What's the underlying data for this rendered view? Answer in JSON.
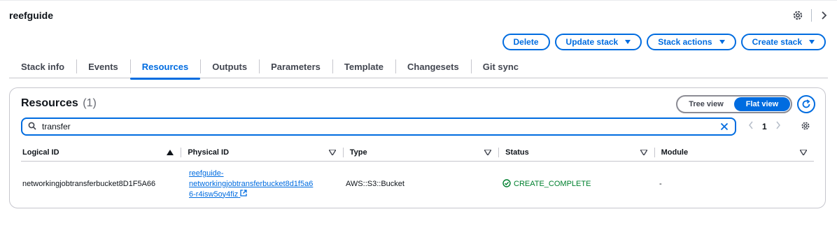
{
  "header": {
    "title": "reefguide",
    "icons": [
      "gear-icon",
      "chevron-right-icon"
    ]
  },
  "actions": {
    "delete": "Delete",
    "update": "Update stack",
    "stack_actions": "Stack actions",
    "create": "Create stack"
  },
  "tabs": [
    {
      "label": "Stack info"
    },
    {
      "label": "Events"
    },
    {
      "label": "Resources"
    },
    {
      "label": "Outputs"
    },
    {
      "label": "Parameters"
    },
    {
      "label": "Template"
    },
    {
      "label": "Changesets"
    },
    {
      "label": "Git sync"
    }
  ],
  "active_tab": "Resources",
  "resources": {
    "title": "Resources",
    "count": "(1)",
    "view_toggle": {
      "tree": "Tree view",
      "flat": "Flat view",
      "selected": "Flat view"
    },
    "search": {
      "value": "transfer"
    },
    "pagination": {
      "page": "1"
    },
    "columns": [
      "Logical ID",
      "Physical ID",
      "Type",
      "Status",
      "Module"
    ],
    "rows": [
      {
        "logical_id": "networkingjobtransferbucket8D1F5A66",
        "physical_id_lines": [
          "reefguide-",
          "networkingjobtransferbucket8d1f5a6",
          "6-r4isw5oy4fiz"
        ],
        "type": "AWS::S3::Bucket",
        "status": "CREATE_COMPLETE",
        "module": "-"
      }
    ]
  },
  "colors": {
    "accent": "#006ce0",
    "success": "#00802f",
    "text": "#0f141a"
  }
}
